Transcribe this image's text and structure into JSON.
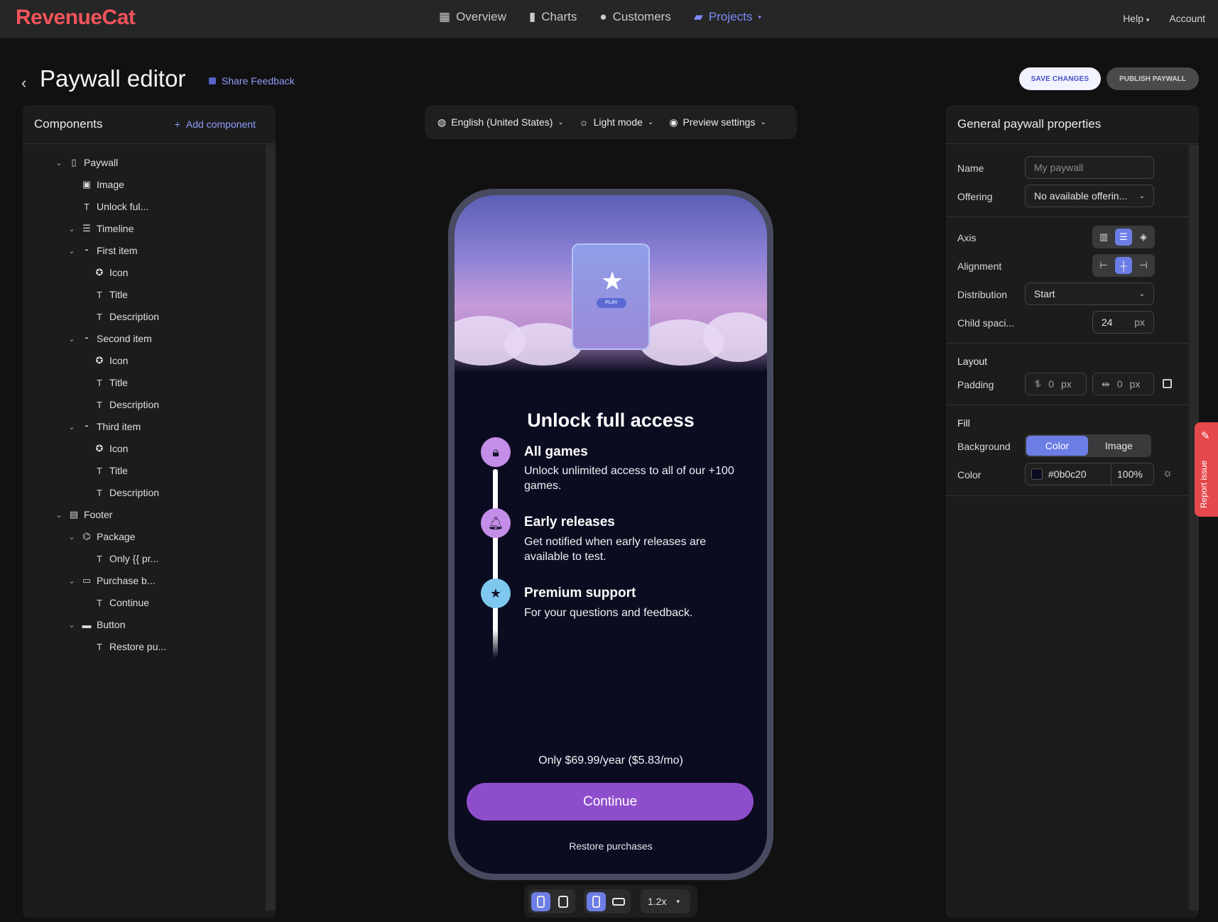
{
  "brand": {
    "logo": "RevenueCat",
    "accent": "#f2545b",
    "link": "#8f9cf9",
    "primary": "#6c7de6"
  },
  "nav": {
    "items": [
      {
        "label": "Overview",
        "icon": "overview-icon"
      },
      {
        "label": "Charts",
        "icon": "charts-icon"
      },
      {
        "label": "Customers",
        "icon": "customers-icon"
      },
      {
        "label": "Projects",
        "icon": "folder-icon",
        "active": true
      }
    ],
    "help": "Help",
    "account": "Account"
  },
  "header": {
    "title": "Paywall editor",
    "feedback": "Share Feedback",
    "save": "SAVE CHANGES",
    "publish": "PUBLISH PAYWALL"
  },
  "components": {
    "title": "Components",
    "add": "Add component",
    "tree": [
      {
        "label": "Paywall",
        "level": 0,
        "expandable": true,
        "icon": "phone-icon"
      },
      {
        "label": "Image",
        "level": 1,
        "expandable": false,
        "icon": "image-icon"
      },
      {
        "label": "Unlock ful...",
        "level": 1,
        "expandable": false,
        "icon": "text-icon"
      },
      {
        "label": "Timeline",
        "level": 1,
        "expandable": true,
        "icon": "list-icon"
      },
      {
        "label": "First item",
        "level": 1,
        "expandable": true,
        "icon": "item-icon"
      },
      {
        "label": "Icon",
        "level": 2,
        "expandable": false,
        "icon": "icon-icon"
      },
      {
        "label": "Title",
        "level": 2,
        "expandable": false,
        "icon": "text-icon"
      },
      {
        "label": "Description",
        "level": 2,
        "expandable": false,
        "icon": "text-icon"
      },
      {
        "label": "Second item",
        "level": 1,
        "expandable": true,
        "icon": "item-icon"
      },
      {
        "label": "Icon",
        "level": 2,
        "expandable": false,
        "icon": "icon-icon"
      },
      {
        "label": "Title",
        "level": 2,
        "expandable": false,
        "icon": "text-icon"
      },
      {
        "label": "Description",
        "level": 2,
        "expandable": false,
        "icon": "text-icon"
      },
      {
        "label": "Third item",
        "level": 1,
        "expandable": true,
        "icon": "item-icon"
      },
      {
        "label": "Icon",
        "level": 2,
        "expandable": false,
        "icon": "icon-icon"
      },
      {
        "label": "Title",
        "level": 2,
        "expandable": false,
        "icon": "text-icon"
      },
      {
        "label": "Description",
        "level": 2,
        "expandable": false,
        "icon": "text-icon"
      },
      {
        "label": "Footer",
        "level": 0,
        "expandable": true,
        "icon": "footer-icon"
      },
      {
        "label": "Package",
        "level": 1,
        "expandable": true,
        "icon": "package-icon"
      },
      {
        "label": "Only {{ pr...",
        "level": 2,
        "expandable": false,
        "icon": "text-icon"
      },
      {
        "label": "Purchase b...",
        "level": 1,
        "expandable": true,
        "icon": "purchase-button-icon"
      },
      {
        "label": "Continue",
        "level": 2,
        "expandable": false,
        "icon": "text-icon"
      },
      {
        "label": "Button",
        "level": 1,
        "expandable": true,
        "icon": "button-icon"
      },
      {
        "label": "Restore pu...",
        "level": 2,
        "expandable": false,
        "icon": "text-icon"
      }
    ]
  },
  "toolbar": {
    "language": "English (United States)",
    "mode": "Light mode",
    "preview": "Preview settings"
  },
  "preview": {
    "hero_button": "PLAY",
    "title": "Unlock full access",
    "items": [
      {
        "title": "All games",
        "desc": "Unlock unlimited access to all of our +100 games.",
        "icon": "lock-icon",
        "color": "#c48ee8"
      },
      {
        "title": "Early releases",
        "desc": "Get notified when early releases are available to test.",
        "icon": "bell-icon",
        "color": "#c48ee8"
      },
      {
        "title": "Premium support",
        "desc": "For your questions and feedback.",
        "icon": "star-icon",
        "color": "#7ec8f0"
      }
    ],
    "price": "Only $69.99/year ($5.83/mo)",
    "cta": "Continue",
    "restore": "Restore purchases",
    "background": "#0b0c20"
  },
  "devicebar": {
    "zoom": "1.2x"
  },
  "properties": {
    "title": "General paywall properties",
    "name_label": "Name",
    "name_placeholder": "My paywall",
    "offering_label": "Offering",
    "offering_value": "No available offerin...",
    "axis_label": "Axis",
    "alignment_label": "Alignment",
    "distribution_label": "Distribution",
    "distribution_value": "Start",
    "spacing_label": "Child spaci...",
    "spacing_value": "24",
    "unit": "px",
    "layout_label": "Layout",
    "padding_label": "Padding",
    "padding_v": "0",
    "padding_h": "0",
    "fill_label": "Fill",
    "background_label": "Background",
    "bg_color_opt": "Color",
    "bg_image_opt": "Image",
    "color_label": "Color",
    "color_value": "#0b0c20",
    "opacity_value": "100%"
  },
  "report": "Report issue"
}
